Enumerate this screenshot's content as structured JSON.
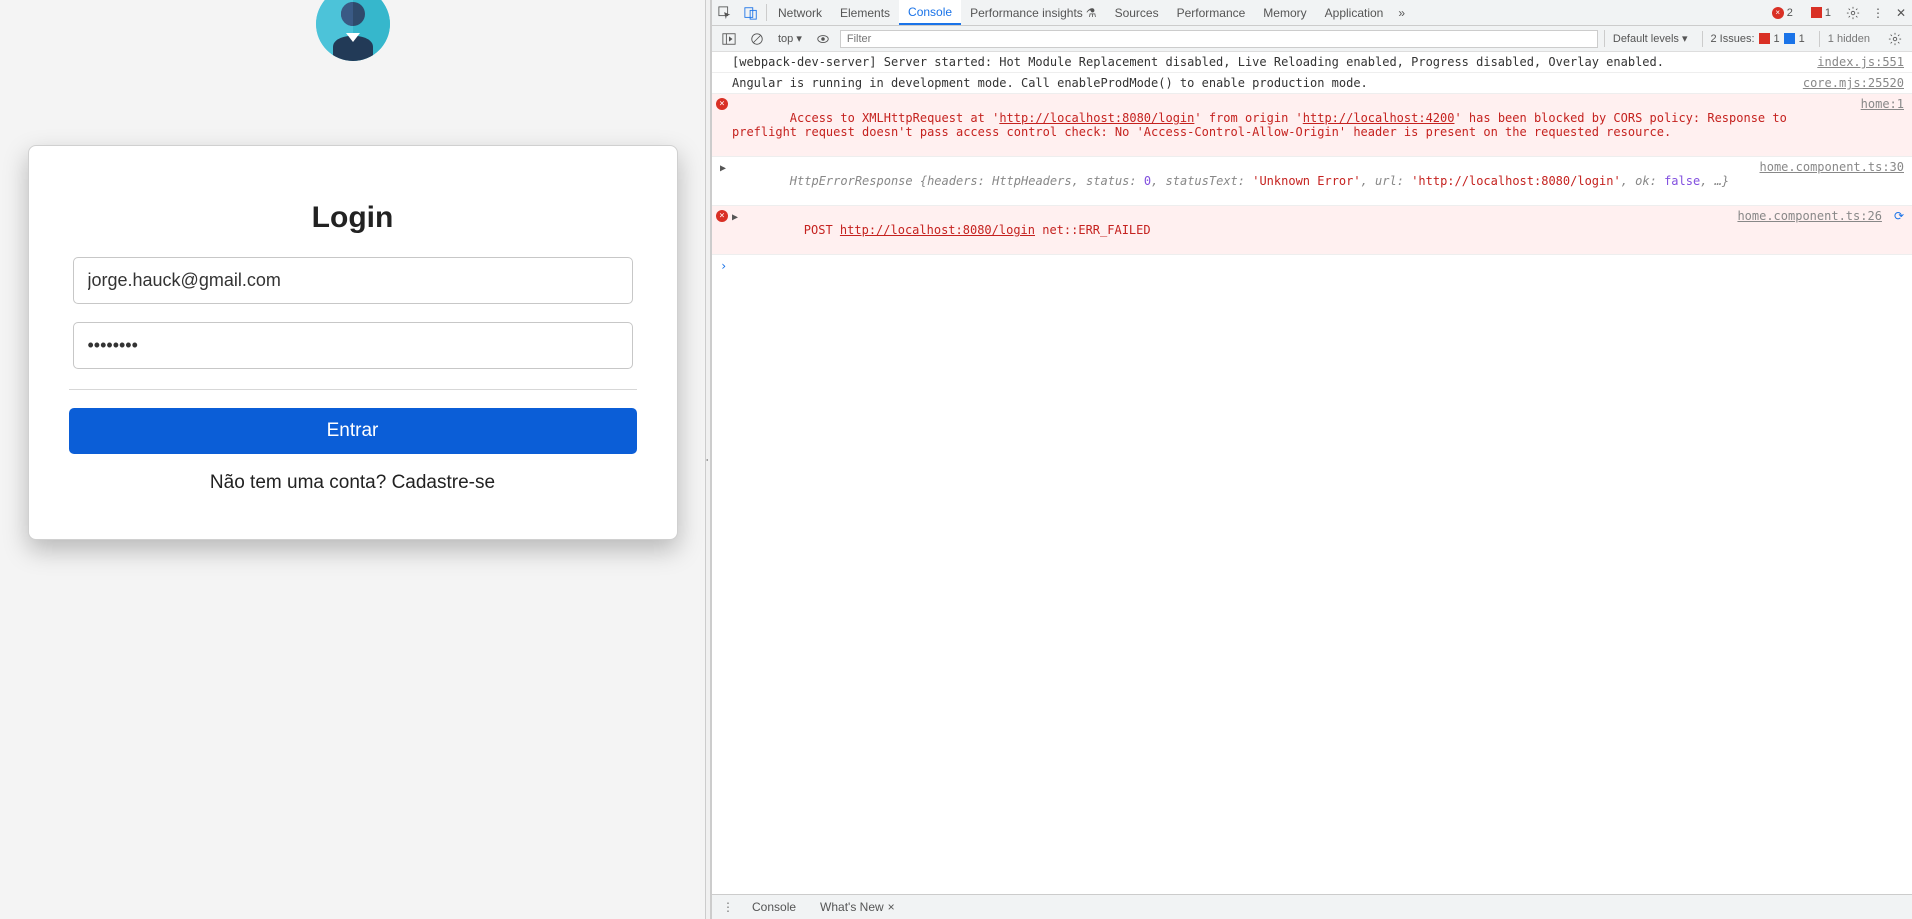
{
  "login": {
    "title": "Login",
    "email_value": "jorge.hauck@gmail.com",
    "password_value": "••••••••",
    "submit_label": "Entrar",
    "signup_prompt_prefix": "Não tem uma conta? ",
    "signup_link": "Cadastre-se"
  },
  "devtools": {
    "tabs": {
      "network": "Network",
      "elements": "Elements",
      "console": "Console",
      "perf_insights": "Performance insights",
      "sources": "Sources",
      "performance": "Performance",
      "memory": "Memory",
      "application": "Application"
    },
    "tab_badges": {
      "errors": "2",
      "issues": "1"
    },
    "toolbar": {
      "context": "top ▾",
      "filter_placeholder": "Filter",
      "default_levels": "Default levels ▾",
      "issues_label": "2 Issues:",
      "issues_red": "1",
      "issues_blue": "1",
      "hidden": "1 hidden"
    },
    "logs": {
      "l0": {
        "msg": "[webpack-dev-server] Server started: Hot Module Replacement disabled, Live Reloading enabled, Progress disabled, Overlay enabled.",
        "src": "index.js:551"
      },
      "l1": {
        "msg": "Angular is running in development mode. Call enableProdMode() to enable production mode.",
        "src": "core.mjs:25520"
      },
      "l2": {
        "pre": "Access to XMLHttpRequest at '",
        "url1": "http://localhost:8080/login",
        "mid": "' from origin '",
        "url2": "http://localhost:4200",
        "post": "' has been blocked by CORS policy: Response to preflight request doesn't pass access control check: No 'Access-Control-Allow-Origin' header is present on the requested resource.",
        "src": "home:1"
      },
      "l3": {
        "obj_name": "HttpErrorResponse",
        "obj_body_prefix": " {headers: ",
        "headers": "HttpHeaders",
        "status_k": ", status: ",
        "status_v": "0",
        "statusText_k": ", statusText: ",
        "statusText_v": "'Unknown Error'",
        "url_k": ", url: ",
        "url_v": "'http://localhost:8080/login'",
        "ok_k": ", ok: ",
        "ok_v": "false",
        "tail": ", …}",
        "src": "home.component.ts:30"
      },
      "l4": {
        "method": "POST ",
        "url": "http://localhost:8080/login",
        "err": " net::ERR_FAILED",
        "src": "home.component.ts:26"
      }
    },
    "drawer": {
      "console": "Console",
      "whatsnew": "What's New"
    }
  }
}
